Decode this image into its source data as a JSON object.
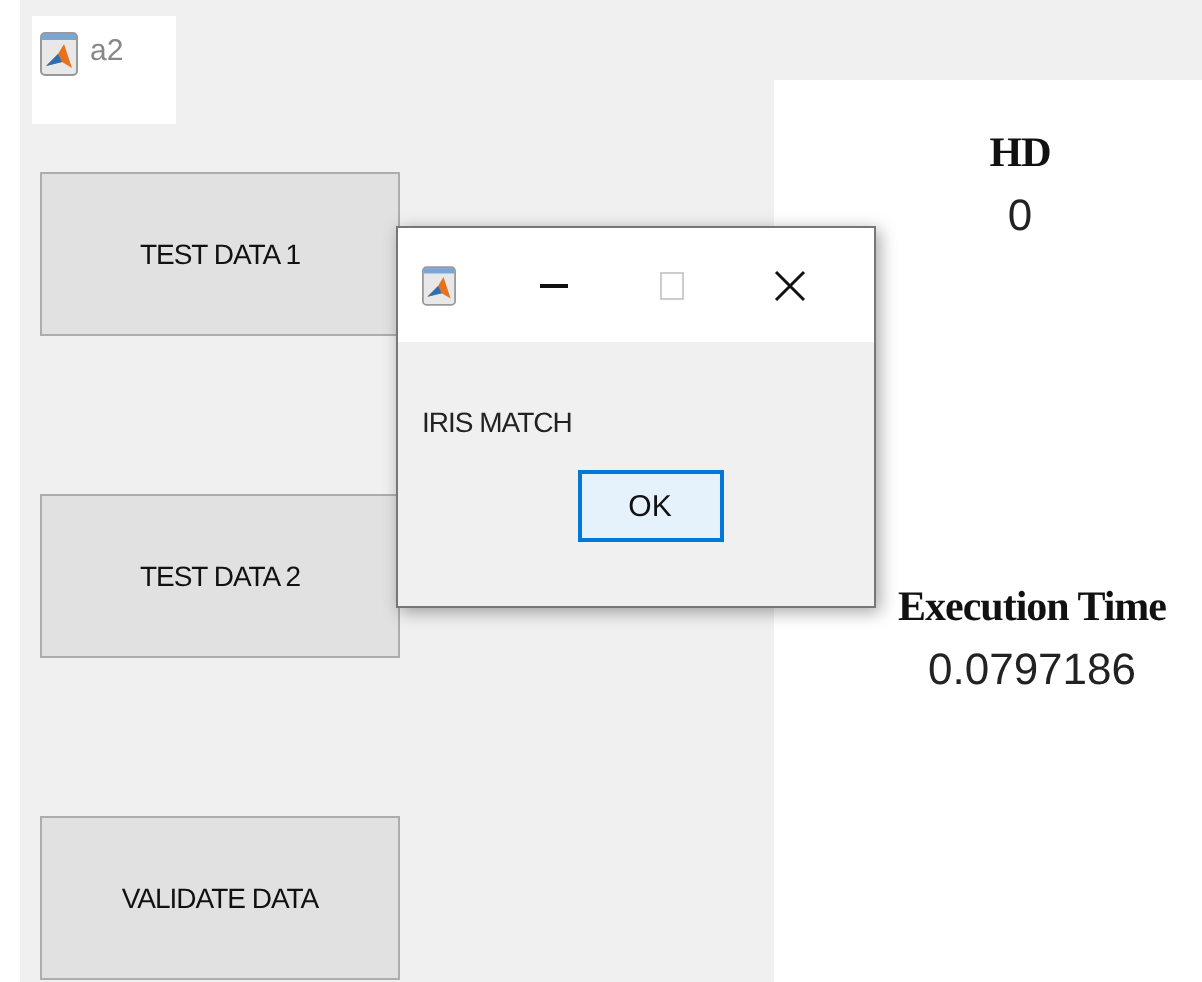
{
  "window": {
    "title": "a2"
  },
  "buttons": [
    "TEST DATA 1",
    "TEST DATA 2",
    "VALIDATE DATA"
  ],
  "dialog": {
    "message": "IRIS MATCH",
    "button": "OK"
  },
  "results": [
    {
      "label": "HD",
      "value": "0"
    },
    {
      "label": "Execution Time",
      "value": "0.0797186"
    }
  ]
}
